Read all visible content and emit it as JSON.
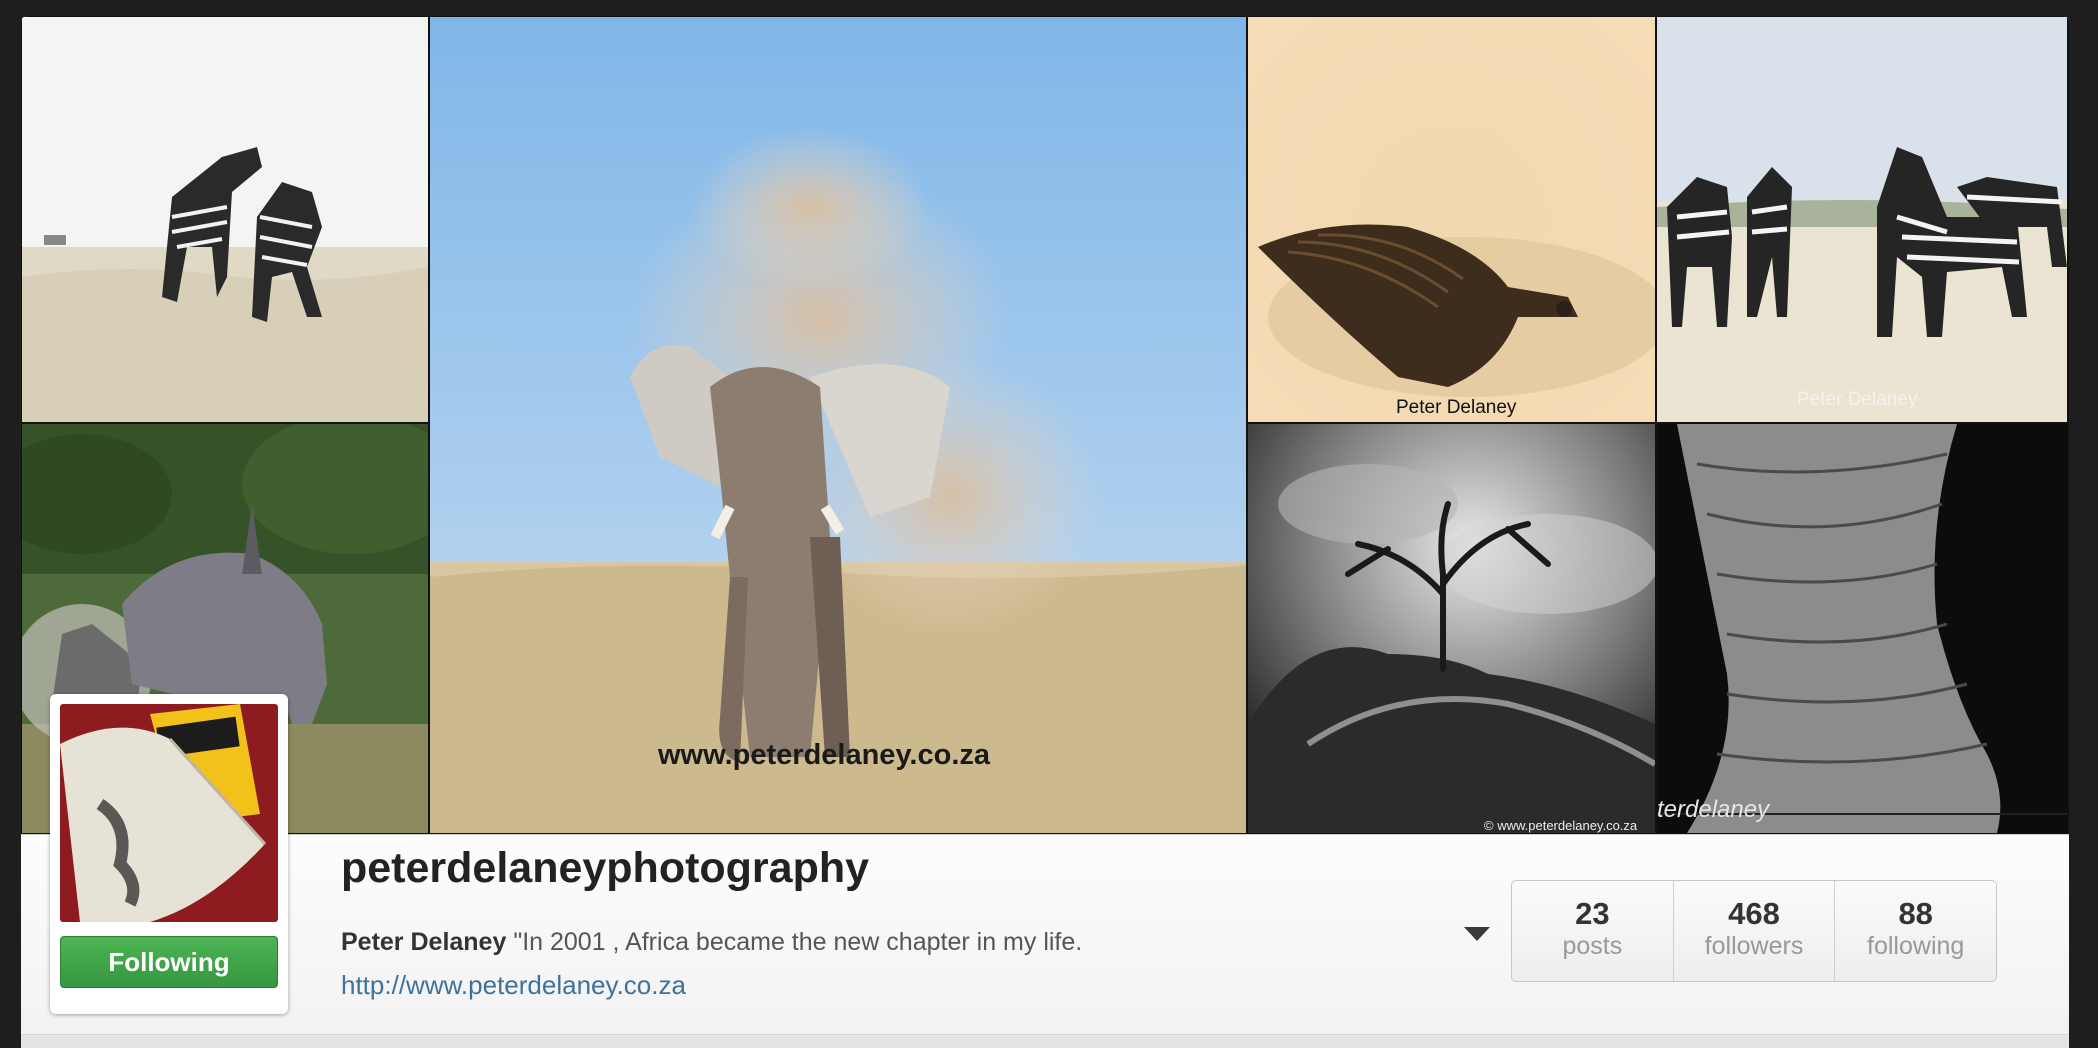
{
  "grid": {
    "tiles": [
      {
        "name": "zebras-fighting"
      },
      {
        "name": "elephant-dust",
        "watermark": "www.peterdelaney.co.za"
      },
      {
        "name": "vulture-dust",
        "watermark": "Peter Delaney"
      },
      {
        "name": "zebra-herd",
        "watermark": "Peter Delaney"
      },
      {
        "name": "rhino"
      },
      {
        "name": "dead-tree-bw",
        "watermark": "© www.peterdelaney.co.za"
      },
      {
        "name": "elephant-leg-bw",
        "watermark": "terdelaney"
      }
    ]
  },
  "profile": {
    "username": "peterdelaneyphotography",
    "bio_name": "Peter Delaney",
    "bio_text": " \"In 2001 , Africa became the new chapter in my life.",
    "website": "http://www.peterdelaney.co.za",
    "follow_label": "Following"
  },
  "stats": [
    {
      "value": "23",
      "label": "posts"
    },
    {
      "value": "468",
      "label": "followers"
    },
    {
      "value": "88",
      "label": "following"
    }
  ],
  "colors": {
    "follow_green": "#3aa443",
    "link_blue": "#3f729b"
  },
  "icons": {
    "dropdown": "chevron-down-icon"
  }
}
